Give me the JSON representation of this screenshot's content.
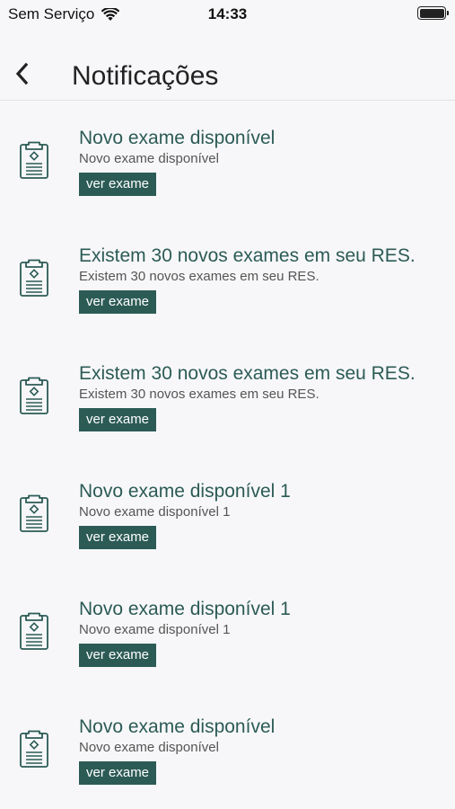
{
  "status_bar": {
    "carrier": "Sem Serviço",
    "time": "14:33",
    "wifi_icon": "wifi-icon",
    "battery_icon": "battery-icon",
    "battery_level": 1.0
  },
  "nav": {
    "back_icon": "chevron-left-icon",
    "title": "Notificações"
  },
  "colors": {
    "accent": "#2c5b56",
    "background": "#f7f7f9"
  },
  "notifications": [
    {
      "title": "Novo exame disponível",
      "subtitle": "Novo exame disponível",
      "button_label": "ver exame",
      "icon": "clipboard-icon"
    },
    {
      "title": "Existem 30 novos exames em seu RES.",
      "subtitle": "Existem 30 novos exames em seu RES.",
      "button_label": "ver exame",
      "icon": "clipboard-icon"
    },
    {
      "title": "Existem 30 novos exames em seu RES.",
      "subtitle": "Existem 30 novos exames em seu RES.",
      "button_label": "ver exame",
      "icon": "clipboard-icon"
    },
    {
      "title": "Novo exame disponível 1",
      "subtitle": "Novo exame disponível 1",
      "button_label": "ver exame",
      "icon": "clipboard-icon"
    },
    {
      "title": "Novo exame disponível 1",
      "subtitle": "Novo exame disponível 1",
      "button_label": "ver exame",
      "icon": "clipboard-icon"
    },
    {
      "title": "Novo exame disponível",
      "subtitle": "Novo exame disponível",
      "button_label": "ver exame",
      "icon": "clipboard-icon"
    }
  ]
}
